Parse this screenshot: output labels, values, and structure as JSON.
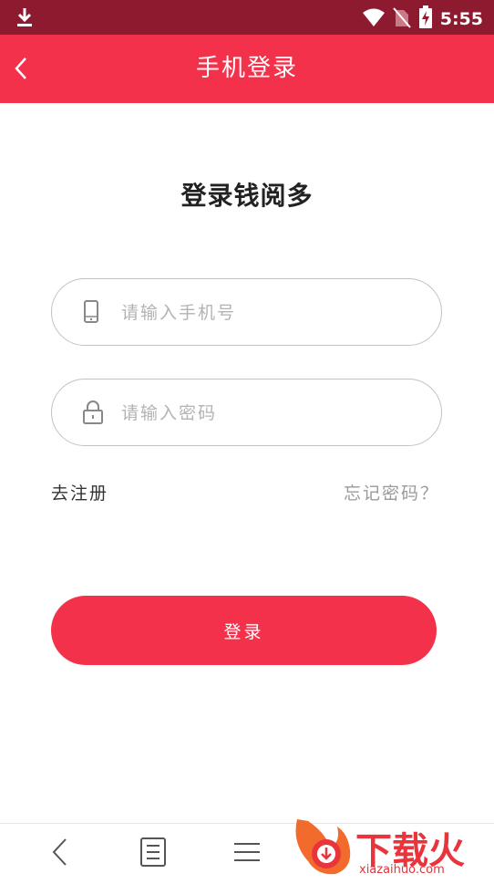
{
  "status_bar": {
    "time": "5:55",
    "icons": [
      "download-icon",
      "wifi-icon",
      "no-sim-icon",
      "battery-charging-icon"
    ]
  },
  "app_bar": {
    "title": "手机登录",
    "back_icon": "chevron-left-icon"
  },
  "main": {
    "heading": "登录钱阅多",
    "phone_field": {
      "placeholder": "请输入手机号",
      "value": "",
      "icon": "phone-icon"
    },
    "password_field": {
      "placeholder": "请输入密码",
      "value": "",
      "icon": "lock-icon"
    },
    "register_link": "去注册",
    "forgot_link": "忘记密码？",
    "login_button": "登录"
  },
  "nav_bar": {
    "buttons": [
      "back-icon",
      "list-icon",
      "menu-icon"
    ]
  },
  "watermark": {
    "text": "下载火",
    "domain": "xiazaihuo.com"
  },
  "colors": {
    "accent": "#f4314b",
    "status_bar": "#8e1a30",
    "watermark": "#e8343a"
  }
}
